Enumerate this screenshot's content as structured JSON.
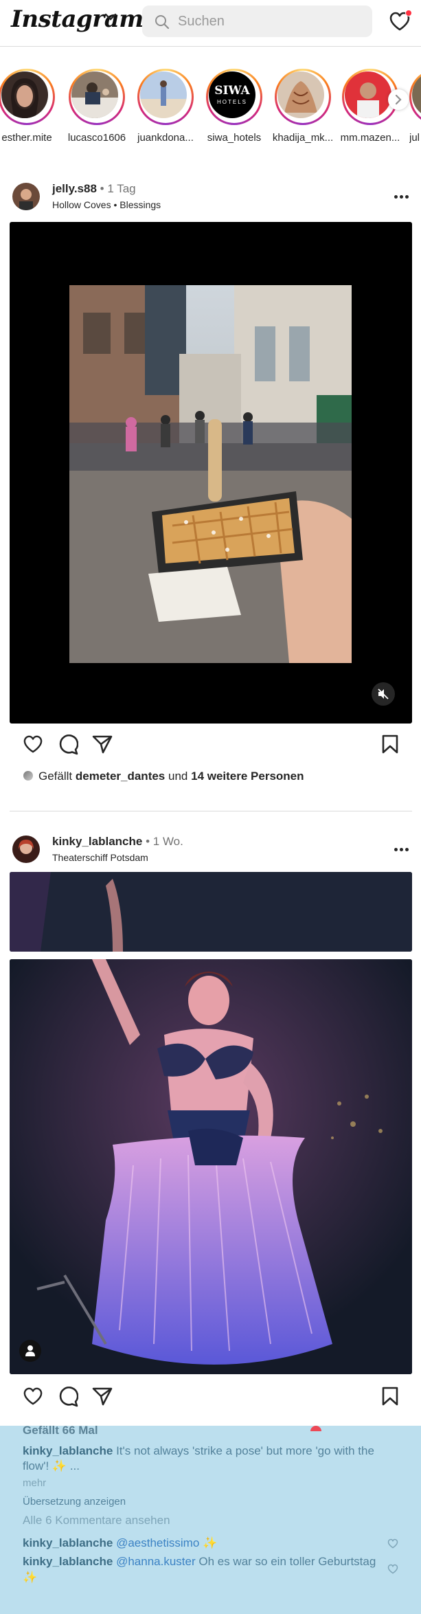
{
  "header": {
    "logo": "Instagram",
    "search_placeholder": "Suchen",
    "has_notification": true
  },
  "stories": [
    {
      "username": "esther.mite",
      "avatar": "portrait-dark-hair"
    },
    {
      "username": "lucasco1606",
      "avatar": "group-table"
    },
    {
      "username": "juankdona...",
      "avatar": "beach-person"
    },
    {
      "username": "siwa_hotels",
      "avatar": "siwa-logo",
      "logo_text_1": "SIWA",
      "logo_text_2": "HOTELS"
    },
    {
      "username": "khadija_mk...",
      "avatar": "henna-hand"
    },
    {
      "username": "mm.mazen...",
      "avatar": "man-red-background"
    },
    {
      "username": "jul",
      "avatar": "partial"
    }
  ],
  "posts": [
    {
      "username": "jelly.s88",
      "separator": "•",
      "time": "1 Tag",
      "location": "Hollow Coves • Blessings",
      "media_type": "video",
      "media_icon": "mute-icon",
      "likes_prefix": "Gefällt",
      "likes_user": "demeter_dantes",
      "likes_middle": "und",
      "likes_others": "14 weitere Personen"
    },
    {
      "username": "kinky_lablanche",
      "separator": "•",
      "time": "1 Wo.",
      "location": "Theaterschiff Potsdam",
      "media_type": "image",
      "media_icon": "user-tag-icon"
    }
  ],
  "comments_panel": {
    "likes_label": "Gefällt 66 Mal",
    "caption_user": "kinky_lablanche",
    "caption_text_1": "It's not always 'strike a pose' but more 'go with the",
    "caption_text_2": "flow'! ✨ ...",
    "more_label": "mehr",
    "translate_label": "Übersetzung anzeigen",
    "view_all_label": "Alle 6 Kommentare ansehen",
    "comments": [
      {
        "user": "kinky_lablanche",
        "mention": "@aesthetissimo",
        "text": " ✨"
      },
      {
        "user": "kinky_lablanche",
        "mention": "@hanna.kuster",
        "text": " Oh es war so ein toller Geburtstag",
        "text_2": "✨"
      }
    ]
  },
  "colors": {
    "accent_red": "#ff3040",
    "panel_bg": "#bcdfee",
    "link_blue": "#3b82c4"
  }
}
